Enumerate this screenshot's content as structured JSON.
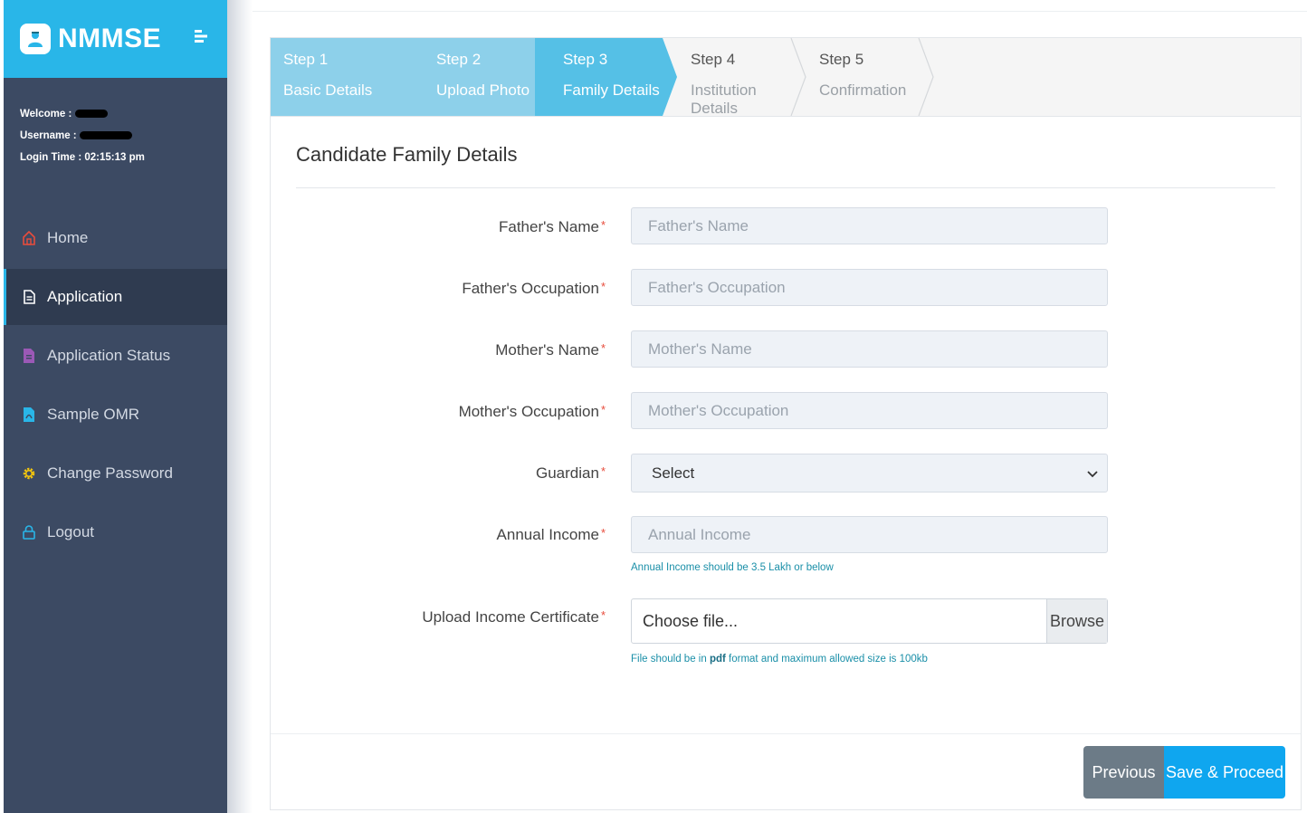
{
  "brand": {
    "name": "NMMSE"
  },
  "user": {
    "welcome_label": "Welcome :",
    "username_label": "Username :",
    "login_time_label": "Login Time :",
    "login_time": "02:15:13 pm"
  },
  "nav": [
    {
      "label": "Home",
      "icon": "home-icon",
      "color": "#e74c3c"
    },
    {
      "label": "Application",
      "icon": "document-icon",
      "color": "#ffffff",
      "active": true
    },
    {
      "label": "Application Status",
      "icon": "file-icon",
      "color": "#9b59b6"
    },
    {
      "label": "Sample OMR",
      "icon": "pdf-file-icon",
      "color": "#29b6e8"
    },
    {
      "label": "Change Password",
      "icon": "gear-icon",
      "color": "#f1c40f"
    },
    {
      "label": "Logout",
      "icon": "lock-icon",
      "color": "#29b6e8"
    }
  ],
  "steps": [
    {
      "num": "Step 1",
      "label": "Basic Details",
      "state": "done"
    },
    {
      "num": "Step 2",
      "label": "Upload Photo",
      "state": "done"
    },
    {
      "num": "Step 3",
      "label": "Family Details",
      "state": "current"
    },
    {
      "num": "Step 4",
      "label": "Institution Details",
      "state": "pending"
    },
    {
      "num": "Step 5",
      "label": "Confirmation",
      "state": "pending"
    }
  ],
  "form": {
    "title": "Candidate Family Details",
    "father_name": {
      "label": "Father's Name",
      "placeholder": "Father's Name",
      "value": ""
    },
    "father_occupation": {
      "label": "Father's Occupation",
      "placeholder": "Father's Occupation",
      "value": ""
    },
    "mother_name": {
      "label": "Mother's Name",
      "placeholder": "Mother's Name",
      "value": ""
    },
    "mother_occupation": {
      "label": "Mother's Occupation",
      "placeholder": "Mother's Occupation",
      "value": ""
    },
    "guardian": {
      "label": "Guardian",
      "selected": "Select"
    },
    "annual_income": {
      "label": "Annual Income",
      "placeholder": "Annual Income",
      "value": "",
      "hint": "Annual Income should be 3.5 Lakh or below"
    },
    "income_certificate": {
      "label": "Upload Income Certificate",
      "file_text": "Choose file...",
      "browse_label": "Browse",
      "hint_before": "File should be in ",
      "hint_bold": "pdf",
      "hint_after": " format and maximum allowed size is 100kb"
    },
    "required_marker": "*"
  },
  "buttons": {
    "previous": "Previous",
    "save": "Save & Proceed"
  },
  "colors": {
    "accent": "#29b6e8",
    "sidebar": "#3c4a63",
    "step_done": "#8dd0ea",
    "step_current": "#55c0e6",
    "save": "#0fa6ef",
    "previous": "#6c7b87"
  }
}
